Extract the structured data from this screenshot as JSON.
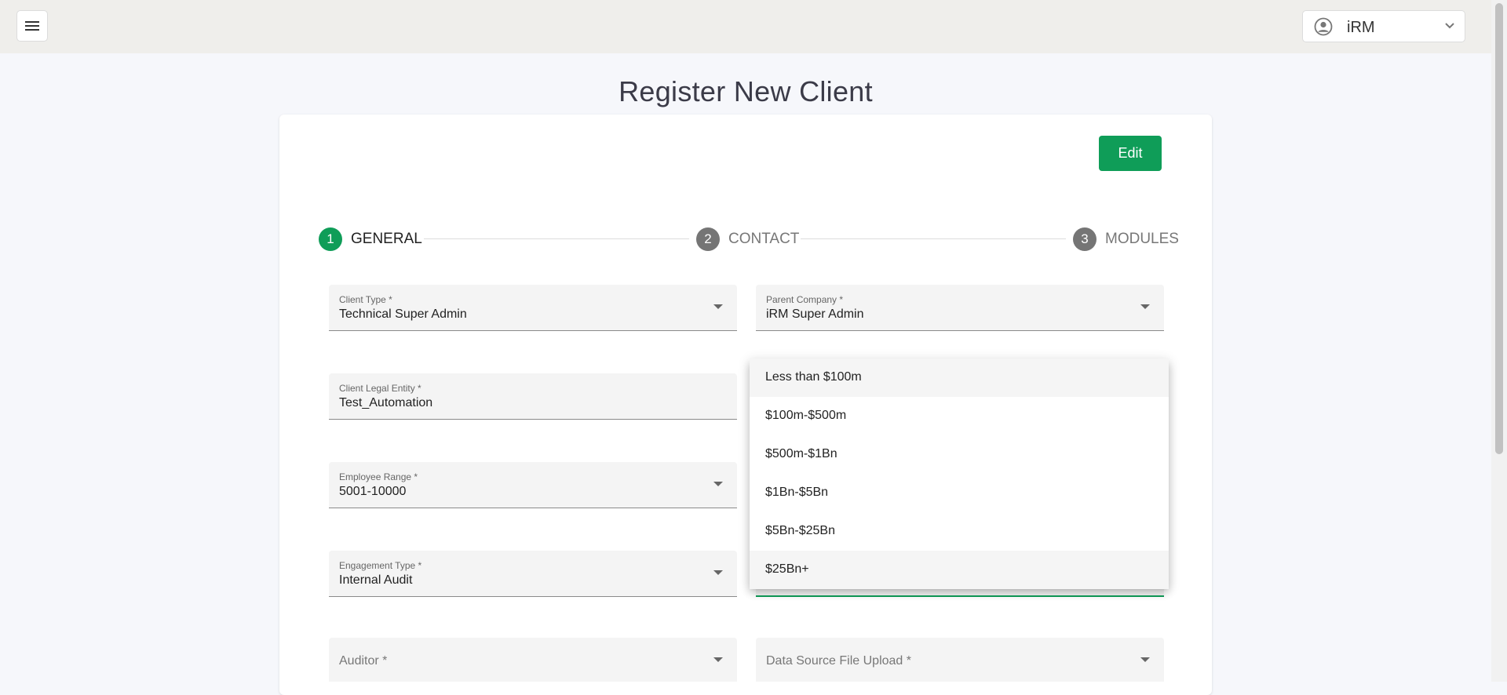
{
  "header": {
    "user_name": "iRM"
  },
  "page": {
    "title": "Register New Client",
    "edit_label": "Edit"
  },
  "stepper": [
    {
      "num": "1",
      "label": "GENERAL",
      "active": true
    },
    {
      "num": "2",
      "label": "CONTACT",
      "active": false
    },
    {
      "num": "3",
      "label": "MODULES",
      "active": false
    }
  ],
  "form": {
    "client_type": {
      "label": "Client Type *",
      "value": "Technical Super Admin"
    },
    "parent_company": {
      "label": "Parent Company *",
      "value": "iRM Super Admin"
    },
    "client_legal_entity": {
      "label": "Client Legal Entity *",
      "value": "Test_Automation"
    },
    "employee_range": {
      "label": "Employee Range *",
      "value": "5001-10000"
    },
    "engagement_type": {
      "label": "Engagement Type *",
      "value": "Internal Audit"
    },
    "auditor": {
      "placeholder": "Auditor *"
    },
    "data_source": {
      "placeholder": "Data Source File Upload *"
    }
  },
  "revenue_dropdown": {
    "options": [
      "Less than $100m",
      "$100m-$500m",
      "$500m-$1Bn",
      "$1Bn-$5Bn",
      "$5Bn-$25Bn",
      "$25Bn+"
    ]
  },
  "colors": {
    "accent": "#0f9d58",
    "header_bg": "#efeeeb",
    "page_bg": "#f6f7fb",
    "step_inactive": "#757575"
  }
}
